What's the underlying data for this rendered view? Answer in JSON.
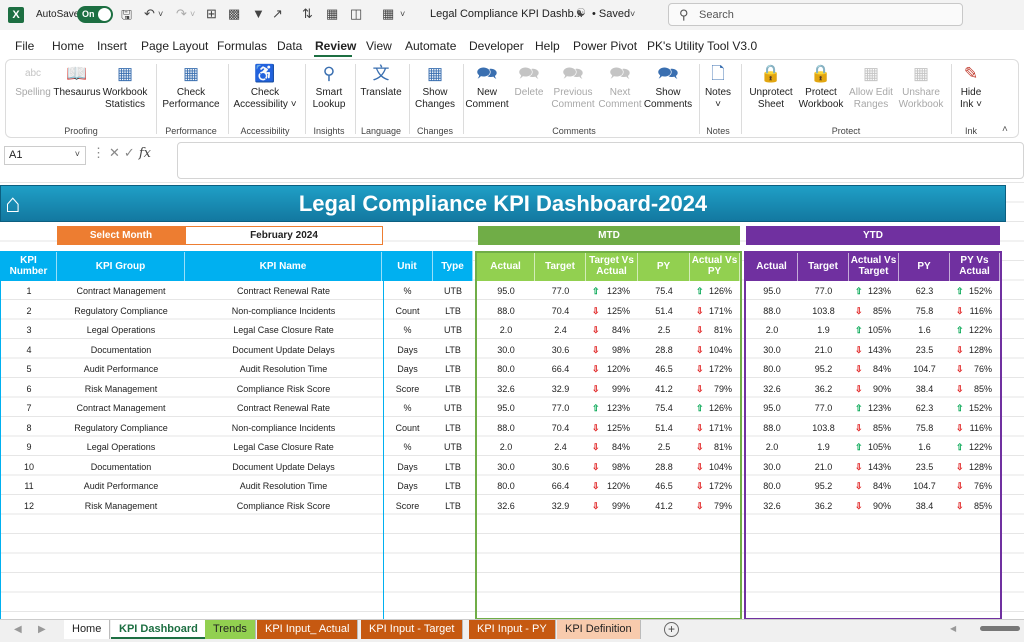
{
  "titlebar": {
    "autosave_label": "AutoSave",
    "toggle_label": "On",
    "doc_title": "Legal Compliance KPI Dashb...",
    "save_state": "• Saved",
    "search_placeholder": "Search"
  },
  "menu": [
    "File",
    "Home",
    "Insert",
    "Page Layout",
    "Formulas",
    "Data",
    "Review",
    "View",
    "Automate",
    "Developer",
    "Help",
    "Power Pivot",
    "PK's Utility Tool V3.0"
  ],
  "active_menu": "Review",
  "ribbon": {
    "spelling": "Spelling",
    "thesaurus": "Thesaurus",
    "workbook_statistics_1": "Workbook",
    "workbook_statistics_2": "Statistics",
    "proofing": "Proofing",
    "check_performance_1": "Check",
    "check_performance_2": "Performance",
    "performance": "Performance",
    "check_accessibility_1": "Check",
    "check_accessibility_2": "Accessibility ˅",
    "accessibility": "Accessibility",
    "smart_lookup_1": "Smart",
    "smart_lookup_2": "Lookup",
    "insights": "Insights",
    "translate": "Translate",
    "language": "Language",
    "show_changes_1": "Show",
    "show_changes_2": "Changes",
    "changes": "Changes",
    "new_comment_1": "New",
    "new_comment_2": "Comment",
    "delete": "Delete",
    "previous_comment_1": "Previous",
    "previous_comment_2": "Comment",
    "next_comment_1": "Next",
    "next_comment_2": "Comment",
    "show_comments_1": "Show",
    "show_comments_2": "Comments",
    "comments": "Comments",
    "notes_btn": "Notes",
    "notes_chev": "˅",
    "notes": "Notes",
    "unprotect_sheet_1": "Unprotect",
    "unprotect_sheet_2": "Sheet",
    "protect_workbook_1": "Protect",
    "protect_workbook_2": "Workbook",
    "allow_edit_ranges_1": "Allow Edit",
    "allow_edit_ranges_2": "Ranges",
    "unshare_workbook_1": "Unshare",
    "unshare_workbook_2": "Workbook",
    "protect": "Protect",
    "hide_ink_1": "Hide",
    "hide_ink_2": "Ink ˅",
    "ink": "Ink"
  },
  "formula_bar": {
    "name_box": "A1",
    "fx": "fx"
  },
  "dashboard": {
    "title": "Legal Compliance KPI Dashboard-2024",
    "select_month_label": "Select Month",
    "select_month_value": "February 2024",
    "mtd_label": "MTD",
    "ytd_label": "YTD",
    "headers_left": [
      "KPI Number",
      "KPI Group",
      "KPI Name",
      "Unit",
      "Type"
    ],
    "headers_mtd": [
      "Actual",
      "Target",
      "Target Vs Actual",
      "PY",
      "Actual Vs PY"
    ],
    "headers_ytd": [
      "Actual",
      "Target",
      "Actual Vs Target",
      "PY",
      "PY Vs Actual"
    ],
    "rows": [
      {
        "num": "1",
        "group": "Contract Management",
        "name": "Contract Renewal Rate",
        "unit": "%",
        "type": "UTB",
        "m_act": "95.0",
        "m_tgt": "77.0",
        "m_tva_dir": "up",
        "m_tva": "123%",
        "m_py": "75.4",
        "m_avp_dir": "up",
        "m_avp": "126%",
        "y_act": "95.0",
        "y_tgt": "77.0",
        "y_avt_dir": "up",
        "y_avt": "123%",
        "y_py": "62.3",
        "y_pva_dir": "up",
        "y_pva": "152%"
      },
      {
        "num": "2",
        "group": "Regulatory Compliance",
        "name": "Non-compliance Incidents",
        "unit": "Count",
        "type": "LTB",
        "m_act": "88.0",
        "m_tgt": "70.4",
        "m_tva_dir": "down",
        "m_tva": "125%",
        "m_py": "51.4",
        "m_avp_dir": "down",
        "m_avp": "171%",
        "y_act": "88.0",
        "y_tgt": "103.8",
        "y_avt_dir": "down",
        "y_avt": "85%",
        "y_py": "75.8",
        "y_pva_dir": "down",
        "y_pva": "116%"
      },
      {
        "num": "3",
        "group": "Legal Operations",
        "name": "Legal Case Closure Rate",
        "unit": "%",
        "type": "UTB",
        "m_act": "2.0",
        "m_tgt": "2.4",
        "m_tva_dir": "down",
        "m_tva": "84%",
        "m_py": "2.5",
        "m_avp_dir": "down",
        "m_avp": "81%",
        "y_act": "2.0",
        "y_tgt": "1.9",
        "y_avt_dir": "up",
        "y_avt": "105%",
        "y_py": "1.6",
        "y_pva_dir": "up",
        "y_pva": "122%"
      },
      {
        "num": "4",
        "group": "Documentation",
        "name": "Document Update Delays",
        "unit": "Days",
        "type": "LTB",
        "m_act": "30.0",
        "m_tgt": "30.6",
        "m_tva_dir": "down",
        "m_tva": "98%",
        "m_py": "28.8",
        "m_avp_dir": "down",
        "m_avp": "104%",
        "y_act": "30.0",
        "y_tgt": "21.0",
        "y_avt_dir": "down",
        "y_avt": "143%",
        "y_py": "23.5",
        "y_pva_dir": "down",
        "y_pva": "128%"
      },
      {
        "num": "5",
        "group": "Audit Performance",
        "name": "Audit Resolution Time",
        "unit": "Days",
        "type": "LTB",
        "m_act": "80.0",
        "m_tgt": "66.4",
        "m_tva_dir": "down",
        "m_tva": "120%",
        "m_py": "46.5",
        "m_avp_dir": "down",
        "m_avp": "172%",
        "y_act": "80.0",
        "y_tgt": "95.2",
        "y_avt_dir": "down",
        "y_avt": "84%",
        "y_py": "104.7",
        "y_pva_dir": "down",
        "y_pva": "76%"
      },
      {
        "num": "6",
        "group": "Risk Management",
        "name": "Compliance Risk Score",
        "unit": "Score",
        "type": "LTB",
        "m_act": "32.6",
        "m_tgt": "32.9",
        "m_tva_dir": "down",
        "m_tva": "99%",
        "m_py": "41.2",
        "m_avp_dir": "down",
        "m_avp": "79%",
        "y_act": "32.6",
        "y_tgt": "36.2",
        "y_avt_dir": "down",
        "y_avt": "90%",
        "y_py": "38.4",
        "y_pva_dir": "down",
        "y_pva": "85%"
      },
      {
        "num": "7",
        "group": "Contract Management",
        "name": "Contract Renewal Rate",
        "unit": "%",
        "type": "UTB",
        "m_act": "95.0",
        "m_tgt": "77.0",
        "m_tva_dir": "up",
        "m_tva": "123%",
        "m_py": "75.4",
        "m_avp_dir": "up",
        "m_avp": "126%",
        "y_act": "95.0",
        "y_tgt": "77.0",
        "y_avt_dir": "up",
        "y_avt": "123%",
        "y_py": "62.3",
        "y_pva_dir": "up",
        "y_pva": "152%"
      },
      {
        "num": "8",
        "group": "Regulatory Compliance",
        "name": "Non-compliance Incidents",
        "unit": "Count",
        "type": "LTB",
        "m_act": "88.0",
        "m_tgt": "70.4",
        "m_tva_dir": "down",
        "m_tva": "125%",
        "m_py": "51.4",
        "m_avp_dir": "down",
        "m_avp": "171%",
        "y_act": "88.0",
        "y_tgt": "103.8",
        "y_avt_dir": "down",
        "y_avt": "85%",
        "y_py": "75.8",
        "y_pva_dir": "down",
        "y_pva": "116%"
      },
      {
        "num": "9",
        "group": "Legal Operations",
        "name": "Legal Case Closure Rate",
        "unit": "%",
        "type": "UTB",
        "m_act": "2.0",
        "m_tgt": "2.4",
        "m_tva_dir": "down",
        "m_tva": "84%",
        "m_py": "2.5",
        "m_avp_dir": "down",
        "m_avp": "81%",
        "y_act": "2.0",
        "y_tgt": "1.9",
        "y_avt_dir": "up",
        "y_avt": "105%",
        "y_py": "1.6",
        "y_pva_dir": "up",
        "y_pva": "122%"
      },
      {
        "num": "10",
        "group": "Documentation",
        "name": "Document Update Delays",
        "unit": "Days",
        "type": "LTB",
        "m_act": "30.0",
        "m_tgt": "30.6",
        "m_tva_dir": "down",
        "m_tva": "98%",
        "m_py": "28.8",
        "m_avp_dir": "down",
        "m_avp": "104%",
        "y_act": "30.0",
        "y_tgt": "21.0",
        "y_avt_dir": "down",
        "y_avt": "143%",
        "y_py": "23.5",
        "y_pva_dir": "down",
        "y_pva": "128%"
      },
      {
        "num": "11",
        "group": "Audit Performance",
        "name": "Audit Resolution Time",
        "unit": "Days",
        "type": "LTB",
        "m_act": "80.0",
        "m_tgt": "66.4",
        "m_tva_dir": "down",
        "m_tva": "120%",
        "m_py": "46.5",
        "m_avp_dir": "down",
        "m_avp": "172%",
        "y_act": "80.0",
        "y_tgt": "95.2",
        "y_avt_dir": "down",
        "y_avt": "84%",
        "y_py": "104.7",
        "y_pva_dir": "down",
        "y_pva": "76%"
      },
      {
        "num": "12",
        "group": "Risk Management",
        "name": "Compliance Risk Score",
        "unit": "Score",
        "type": "LTB",
        "m_act": "32.6",
        "m_tgt": "32.9",
        "m_tva_dir": "down",
        "m_tva": "99%",
        "m_py": "41.2",
        "m_avp_dir": "down",
        "m_avp": "79%",
        "y_act": "32.6",
        "y_tgt": "36.2",
        "y_avt_dir": "down",
        "y_avt": "90%",
        "y_py": "38.4",
        "y_pva_dir": "down",
        "y_pva": "85%"
      }
    ]
  },
  "sheet_tabs": [
    {
      "label": "Home",
      "bg": "#ffffff",
      "fg": "#222222"
    },
    {
      "label": "KPI Dashboard",
      "bg": "#ffffff",
      "fg": "#1d6f42",
      "active": true
    },
    {
      "label": "Trends",
      "bg": "#92d050",
      "fg": "#222222"
    },
    {
      "label": "KPI Input_ Actual",
      "bg": "#c65911",
      "fg": "#ffffff"
    },
    {
      "label": "KPI Input - Target",
      "bg": "#c65911",
      "fg": "#ffffff"
    },
    {
      "label": "KPI Input - PY",
      "bg": "#c65911",
      "fg": "#ffffff"
    },
    {
      "label": "KPI Definition",
      "bg": "#f8cbad",
      "fg": "#222222"
    }
  ],
  "colors": {
    "header_blue": "#00b0f0",
    "mtd_green": "#70ad47",
    "ytd_purple": "#7030a0",
    "title_teal": "#1f9fc6",
    "arrow_up": "#00a651",
    "arrow_down": "#e02020"
  }
}
